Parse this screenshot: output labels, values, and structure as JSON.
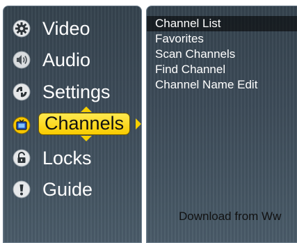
{
  "menu": {
    "items": [
      {
        "label": "Video",
        "icon": "gear-icon"
      },
      {
        "label": "Audio",
        "icon": "speaker-icon"
      },
      {
        "label": "Settings",
        "icon": "settings-icon"
      },
      {
        "label": "Channels",
        "icon": "tv-icon",
        "selected": true
      },
      {
        "label": "Locks",
        "icon": "lock-icon"
      },
      {
        "label": "Guide",
        "icon": "info-icon"
      }
    ]
  },
  "submenu": {
    "items": [
      {
        "label": "Channel List",
        "highlighted": true
      },
      {
        "label": "Favorites"
      },
      {
        "label": "Scan Channels"
      },
      {
        "label": "Find Channel"
      },
      {
        "label": "Channel Name Edit"
      }
    ]
  },
  "watermark": "Download from Ww",
  "colors": {
    "panel_bg": "#3d4c59",
    "selection_yellow": "#f9d000",
    "text": "#ffffff"
  }
}
